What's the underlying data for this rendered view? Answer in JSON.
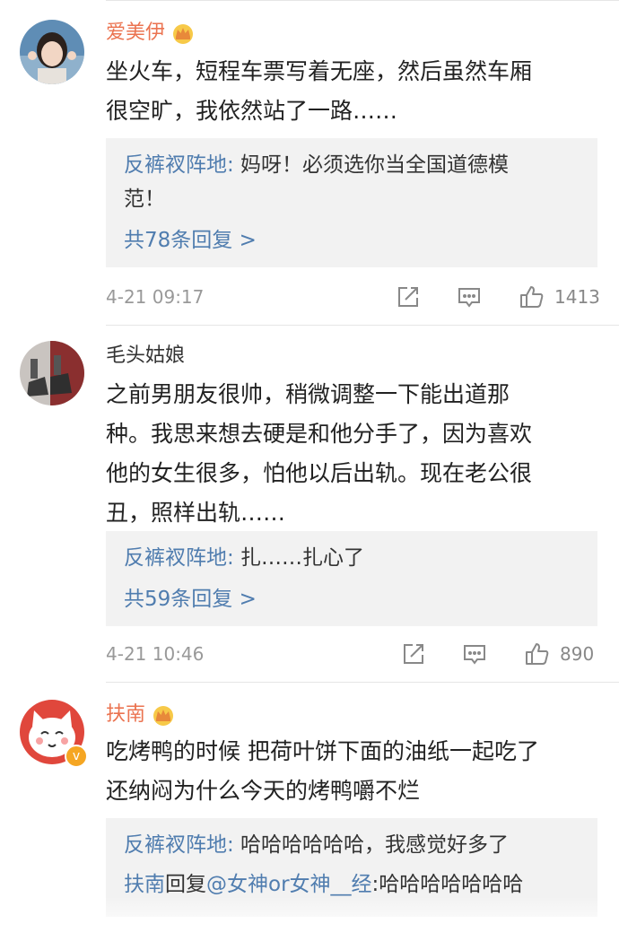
{
  "comments": [
    {
      "user": "爱美伊",
      "body_lines": [
        "坐火车，短程车票写着无座，然后虽然车厢",
        "很空旷，我依然站了一路……"
      ],
      "reply_lines": [
        {
          "author": "反裤衩阵地:",
          "text": " 妈呀！必须选你当全国道德模"
        },
        {
          "author": "",
          "text": "范！"
        }
      ],
      "more_replies": "共78条回复 >",
      "time": "4-21 09:17",
      "likes": "1413"
    },
    {
      "user": "毛头姑娘",
      "body_lines": [
        "之前男朋友很帅，稍微调整一下能出道那",
        "种。我思来想去硬是和他分手了，因为喜欢",
        "他的女生很多，怕他以后出轨。现在老公很",
        "丑，照样出轨……"
      ],
      "reply_lines": [
        {
          "author": "反裤衩阵地:",
          "text": " 扎……扎心了"
        }
      ],
      "more_replies": "共59条回复 >",
      "time": "4-21 10:46",
      "likes": "890"
    },
    {
      "user": "扶南",
      "body_lines": [
        "吃烤鸭的时候 把荷叶饼下面的油纸一起吃了",
        "还纳闷为什么今天的烤鸭嚼不烂"
      ],
      "reply_lines": [
        {
          "author": "反裤衩阵地:",
          "text": " 哈哈哈哈哈哈，我感觉好多了"
        },
        {
          "author": "扶南",
          "text": "回复",
          "mention": "@女神or女神__经",
          "tail": ":哈哈哈哈哈哈哈"
        }
      ]
    }
  ],
  "icons": {
    "share": "share-icon",
    "comment": "comment-icon",
    "like": "thumbs-up-icon",
    "crown": "vip-crown-icon",
    "verified": "verified-v-icon"
  },
  "colors": {
    "vip_name": "#eb7350",
    "link": "#507daf",
    "reply_bg": "#f2f2f2",
    "meta": "#999999"
  },
  "verified_mark": "v"
}
